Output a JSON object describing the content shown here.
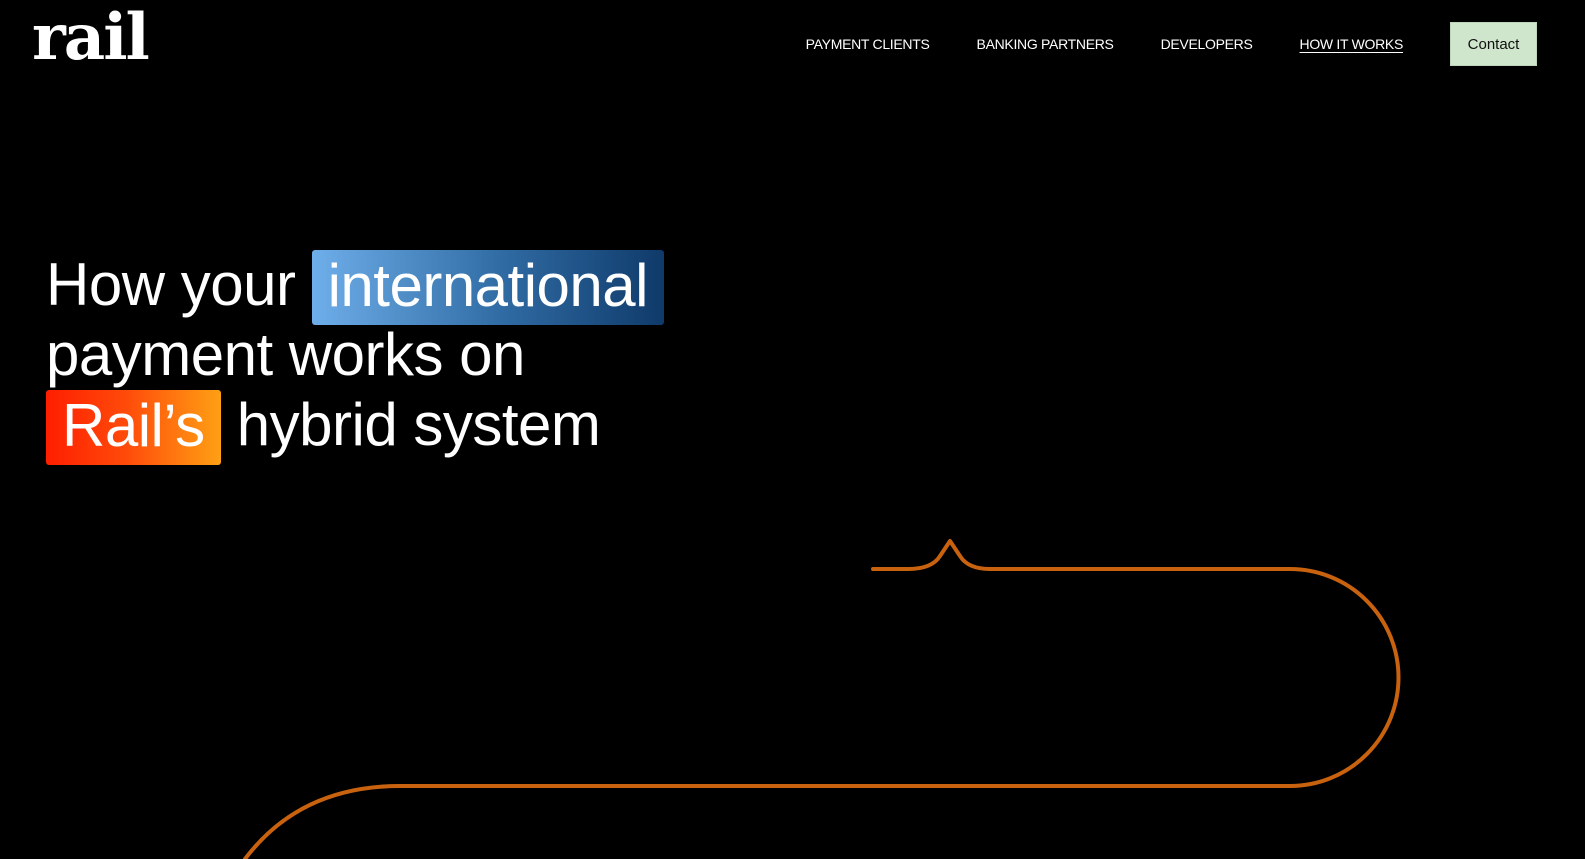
{
  "header": {
    "logo_text": "rail",
    "nav": [
      {
        "label": "PAYMENT CLIENTS",
        "active": false
      },
      {
        "label": "BANKING PARTNERS",
        "active": false
      },
      {
        "label": "DEVELOPERS",
        "active": false
      },
      {
        "label": "HOW IT WORKS",
        "active": true
      }
    ],
    "contact_label": "Contact"
  },
  "hero": {
    "line1_prefix": "How your",
    "line1_highlight": "international",
    "line2": "payment works on",
    "line3_highlight": "Rail’s",
    "line3_suffix": "hybrid system"
  },
  "colors": {
    "background": "#000000",
    "text": "#ffffff",
    "contact_bg": "#cfe6cc",
    "highlight_blue_start": "#6eaeea",
    "highlight_blue_end": "#0f3a6a",
    "highlight_orange_start": "#ff1e00",
    "highlight_orange_end": "#ffa014",
    "rail_line": "#c8620f"
  }
}
